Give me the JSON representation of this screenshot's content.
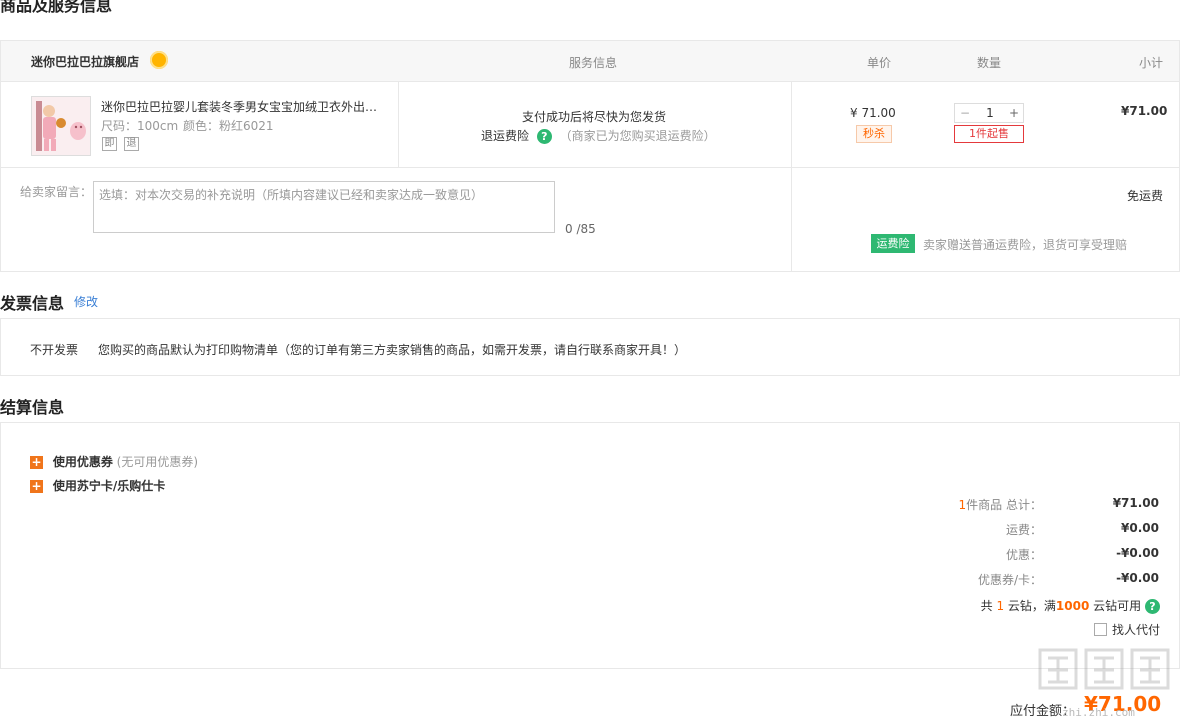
{
  "sections": {
    "goods_title": "商品及服务信息",
    "invoice_title": "发票信息",
    "invoice_edit": "修改",
    "settle_title": "结算信息"
  },
  "cart_header": {
    "store_name": "迷你巴拉巴拉旗舰店",
    "col_service": "服务信息",
    "col_price": "单价",
    "col_qty": "数量",
    "col_subtotal": "小计"
  },
  "item": {
    "title": "迷你巴拉巴拉婴儿套装冬季男女宝宝加绒卫衣外出…",
    "size_label": "尺码：100cm",
    "color_label": "颜色：粉红6021",
    "tag1": "即",
    "tag2": "退",
    "service_line1": "支付成功后将尽快为您发货",
    "service_insurance": "退运费险",
    "service_note": "（商家已为您购买退运费险）",
    "price": "¥ 71.00",
    "promo_badge": "秒杀",
    "qty": "1",
    "qty_minus": "−",
    "qty_plus": "+",
    "min_order": "1件起售",
    "subtotal": "¥71.00"
  },
  "message": {
    "label": "给卖家留言：",
    "placeholder": "选填：对本次交易的补充说明（所填内容建议已经和卖家达成一致意见）",
    "counter": "0 /85",
    "shipping": "免运费",
    "insurance_badge": "运费险",
    "insurance_desc": "卖家赠送普通运费险，退货可享受理赔"
  },
  "invoice": {
    "type": "不开发票",
    "desc": "您购买的商品默认为打印购物清单（您的订单有第三方卖家销售的商品，如需开发票，请自行联系商家开具！）"
  },
  "settle": {
    "coupon_label": "使用优惠券",
    "coupon_note": "(无可用优惠券)",
    "card_label": "使用苏宁卡/乐购仕卡",
    "count_num": "1",
    "count_text": "件商品 总计：",
    "total": "¥71.00",
    "freight_label": "运费：",
    "freight": "¥0.00",
    "discount_label": "优惠：",
    "discount": "-¥0.00",
    "coupon_card_label": "优惠券/卡：",
    "coupon_card": "-¥0.00",
    "diamond_pre": "共",
    "diamond_num": "1",
    "diamond_mid": "云钻，满",
    "diamond_limit": "1000",
    "diamond_post": "云钻可用",
    "proxy_pay": "找人代付"
  },
  "payable": {
    "label": "应付金额：",
    "amount": "¥71.00"
  },
  "watermark": "zhi.zhi.com"
}
